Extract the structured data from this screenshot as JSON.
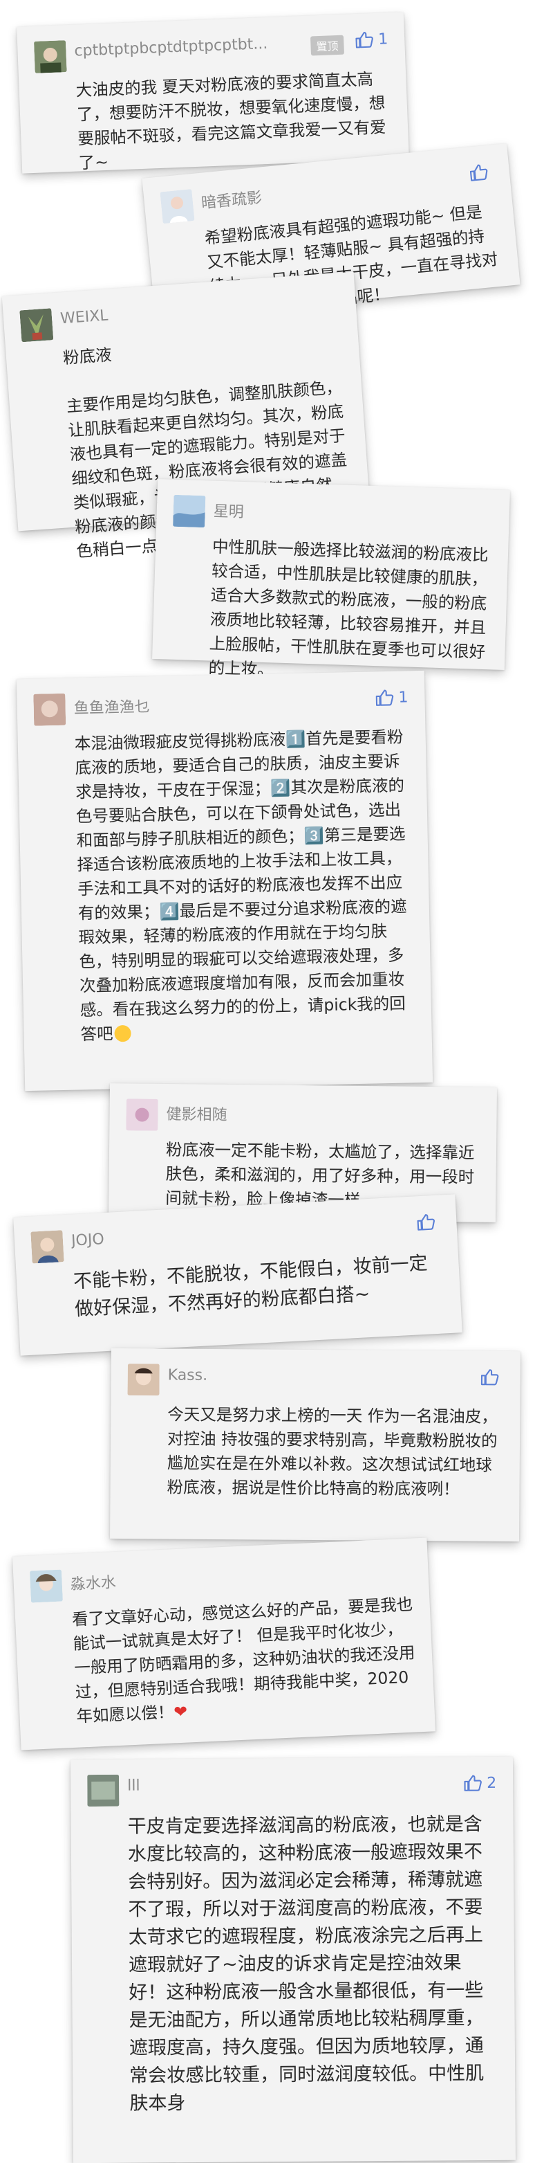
{
  "comments": [
    {
      "name": "cptbtptpbcptdtptpcptbt...",
      "pinned": "置顶",
      "likes": "1",
      "text": "大油皮的我 夏天对粉底液的要求简直太高了，想要防汗不脱妆，想要氧化速度慢，想要服帖不斑驳，看完这篇文章我爱一又有爱了~"
    },
    {
      "name": "暗香疏影",
      "likes": "",
      "text": "希望粉底液具有超强的遮瑕功能~ 但是又不能太厚！轻薄贴服~ 具有超强的持续力~，另外我是大干皮，一直在寻找对干皮友好的底妆产品呢！"
    },
    {
      "name": "WEIXL",
      "likes": "",
      "text": "粉底液\n\n主要作用是均匀肤色，调整肌肤颜色，让肌肤看起来更自然均匀。其次，粉底液也具有一定的遮瑕能力。特别是对于细纹和色斑，粉底液将会很有效的遮盖类似瑕疵，让肌肤看起来更健康自然。粉底液的颜色选择接近肤色，或者比肤色稍白一点为适合。"
    },
    {
      "name": "星明",
      "likes": "",
      "text": "中性肌肤一般选择比较滋润的粉底液比较合适，中性肌肤是比较健康的肌肤，适合大多数款式的粉底液，一般的粉底液质地比较轻薄，比较容易推开，并且上脸服帖，干性肌肤在夏季也可以很好的上妆。"
    },
    {
      "name": "鱼鱼渔渔乜",
      "likes": "1",
      "text": "本混油微瑕疵皮觉得挑粉底液1️⃣首先是要看粉底液的质地，要适合自己的肤质，油皮主要诉求是持妆，干皮在于保湿；2️⃣其次是粉底液的色号要贴合肤色，可以在下颌骨处试色，选出和面部与脖子肌肤相近的颜色；3️⃣第三是要选择适合该粉底液质地的上妆手法和上妆工具，手法和工具不对的话好的粉底液也发挥不出应有的效果；4️⃣最后是不要过分追求粉底液的遮瑕效果，轻薄的粉底液的作用就在于均匀肤色，特别明显的瑕疵可以交给遮瑕液处理，多次叠加粉底液遮瑕度增加有限，反而会加重妆感。看在我这么努力的的份上，请pick我的回答吧"
    },
    {
      "name": "健影相随",
      "likes": "",
      "text": "粉底液一定不能卡粉，太尴尬了，选择靠近肤色，柔和滋润的，用了好多种，用一段时间就卡粉，脸上像掉渣一样"
    },
    {
      "name": "JOJO",
      "likes": "",
      "text": "不能卡粉，不能脱妆，不能假白，妆前一定做好保湿，不然再好的粉底都白搭~"
    },
    {
      "name": "Kass.",
      "likes": "",
      "text": "今天又是努力求上榜的一天 作为一名混油皮，对控油 持妆强的要求特别高，毕竟敷粉脱妆的尴尬实在是在外难以补救。这次想试试红地球粉底液，据说是性价比特高的粉底液咧！"
    },
    {
      "name": "淼水水",
      "likes": "",
      "text": "看了文章好心动，感觉这么好的产品，要是我也能试一试就真是太好了！ 但是我平时化妆少，一般用了防晒霜用的多，这种奶油状的我还没用过，但愿特别适合我哦！期待我能中奖，2020年如愿以偿！"
    },
    {
      "name": "lll",
      "likes": "2",
      "text": "干皮肯定要选择滋润高的粉底液，也就是含水度比较高的，这种粉底液一般遮瑕效果不会特别好。因为滋润必定会稀薄，稀薄就遮不了瑕，所以对于滋润度高的粉底液，不要太苛求它的遮瑕程度，粉底液涂完之后再上遮瑕就好了~油皮的诉求肯定是控油效果好！这种粉底液一般含水量都很低，有一些是无油配方，所以通常质地比较粘稠厚重，遮瑕度高，持久度强。但因为质地较厚，通常会妆感比较重，同时滋润度较低。中性肌肤本身"
    }
  ]
}
